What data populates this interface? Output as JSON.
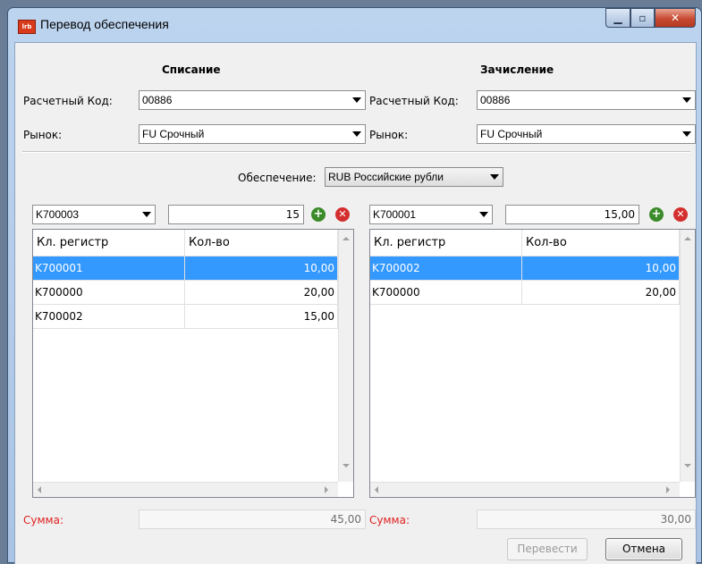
{
  "window": {
    "title": "Перевод обеспечения",
    "app_icon": "app-logo-icon"
  },
  "left": {
    "header": "Списание",
    "code_label": "Расчетный Код:",
    "code_value": "00886",
    "market_label": "Рынок:",
    "market_value": "FU Срочный",
    "register_value": "K700003",
    "amount_value": "15",
    "table": {
      "columns": [
        "Кл. регистр",
        "Кол-во"
      ],
      "rows": [
        {
          "reg": "K700001",
          "qty": "10,00",
          "selected": true
        },
        {
          "reg": "K700000",
          "qty": "20,00",
          "selected": false
        },
        {
          "reg": "K700002",
          "qty": "15,00",
          "selected": false
        }
      ]
    },
    "sum_label": "Сумма:",
    "sum_value": "45,00"
  },
  "right": {
    "header": "Зачисление",
    "code_label": "Расчетный Код:",
    "code_value": "00886",
    "market_label": "Рынок:",
    "market_value": "FU Срочный",
    "register_value": "K700001",
    "amount_value": "15,00",
    "table": {
      "columns": [
        "Кл. регистр",
        "Кол-во"
      ],
      "rows": [
        {
          "reg": "K700002",
          "qty": "10,00",
          "selected": true
        },
        {
          "reg": "K700000",
          "qty": "20,00",
          "selected": false
        }
      ]
    },
    "sum_label": "Сумма:",
    "sum_value": "30,00"
  },
  "collateral": {
    "label": "Обеспечение:",
    "value": "RUB Российские рубли"
  },
  "buttons": {
    "transfer": "Перевести",
    "cancel": "Отмена"
  },
  "colors": {
    "selection": "#3399ff",
    "sum_label": "#e02020",
    "add": "#3c8b2a",
    "delete": "#d42e2e"
  }
}
